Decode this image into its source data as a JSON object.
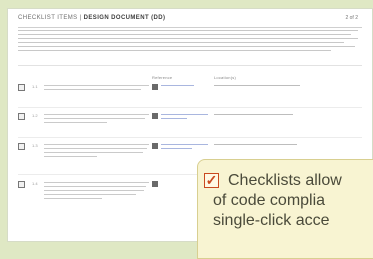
{
  "document": {
    "title_prefix": "CHECKLIST ITEMS |",
    "title_main": "DESIGN DOCUMENT (DD)",
    "page": "2 of 2",
    "columns": {
      "reference": "Reference",
      "location": "Location(s)"
    },
    "items": [
      {
        "num": "1.1"
      },
      {
        "num": "1.2"
      },
      {
        "num": "1.3"
      },
      {
        "num": "1.4"
      }
    ]
  },
  "callout": {
    "line1": "Checklists allow",
    "line2": "of code complia",
    "line3": "single-click acce"
  },
  "colors": {
    "background": "#dfe8c4",
    "callout_bg": "#f8f4d2",
    "check_accent": "#c94a1f",
    "link": "#a9b6df"
  }
}
